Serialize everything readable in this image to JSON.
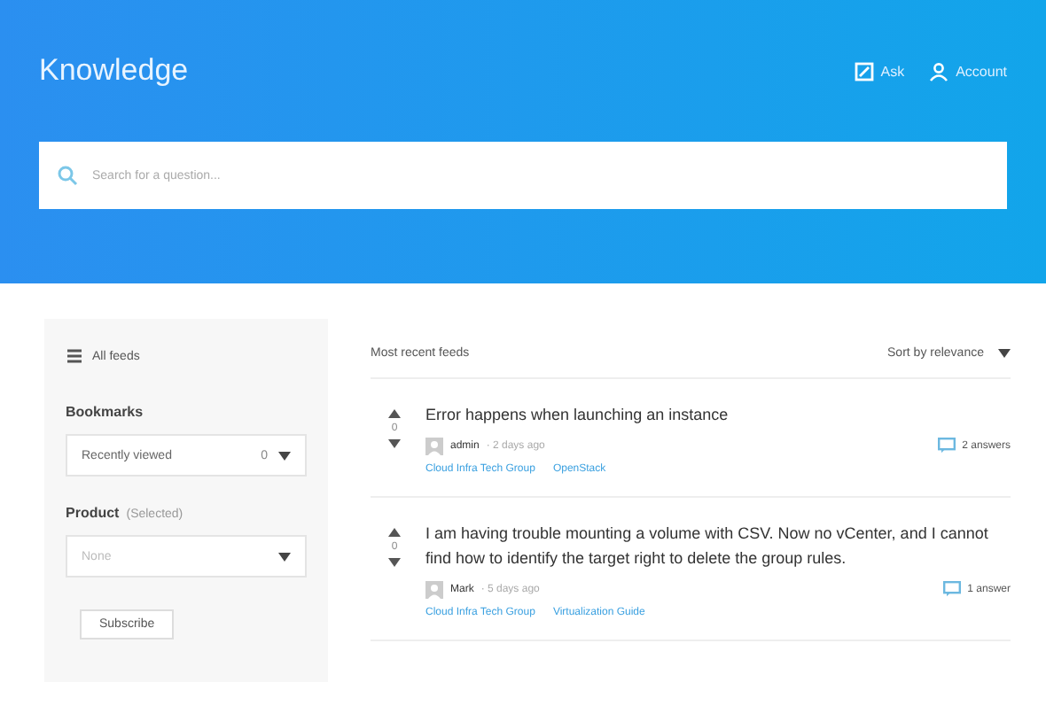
{
  "header": {
    "brand": "Knowledge",
    "actions": [
      {
        "kind": "ask",
        "label": "Ask"
      },
      {
        "kind": "account",
        "label": "Account"
      }
    ]
  },
  "search": {
    "placeholder": "Search for a question..."
  },
  "sidebar": {
    "all_link": "All feeds",
    "bookmarks": {
      "label": "Bookmarks",
      "value": "Recently viewed",
      "count": "0"
    },
    "product": {
      "label": "Product",
      "hint": "(Selected)",
      "value": "None"
    },
    "subscribe": "Subscribe"
  },
  "feed": {
    "title": "Most recent feeds",
    "sort": "Sort by relevance",
    "questions": [
      {
        "votes": "0",
        "title": "Error happens when launching an instance",
        "user": "admin",
        "time": "· 2 days ago",
        "tags": [
          "Cloud Infra Tech Group",
          "OpenStack"
        ],
        "answers": "2 answers"
      },
      {
        "votes": "0",
        "title": "I am having trouble mounting a volume with CSV. Now no vCenter, and I cannot find how to identify the target right to delete the group rules.",
        "user": "Mark",
        "time": "· 5 days ago",
        "tags": [
          "Cloud Infra Tech Group",
          "Virtualization Guide"
        ],
        "answers": "1 answer"
      }
    ]
  }
}
